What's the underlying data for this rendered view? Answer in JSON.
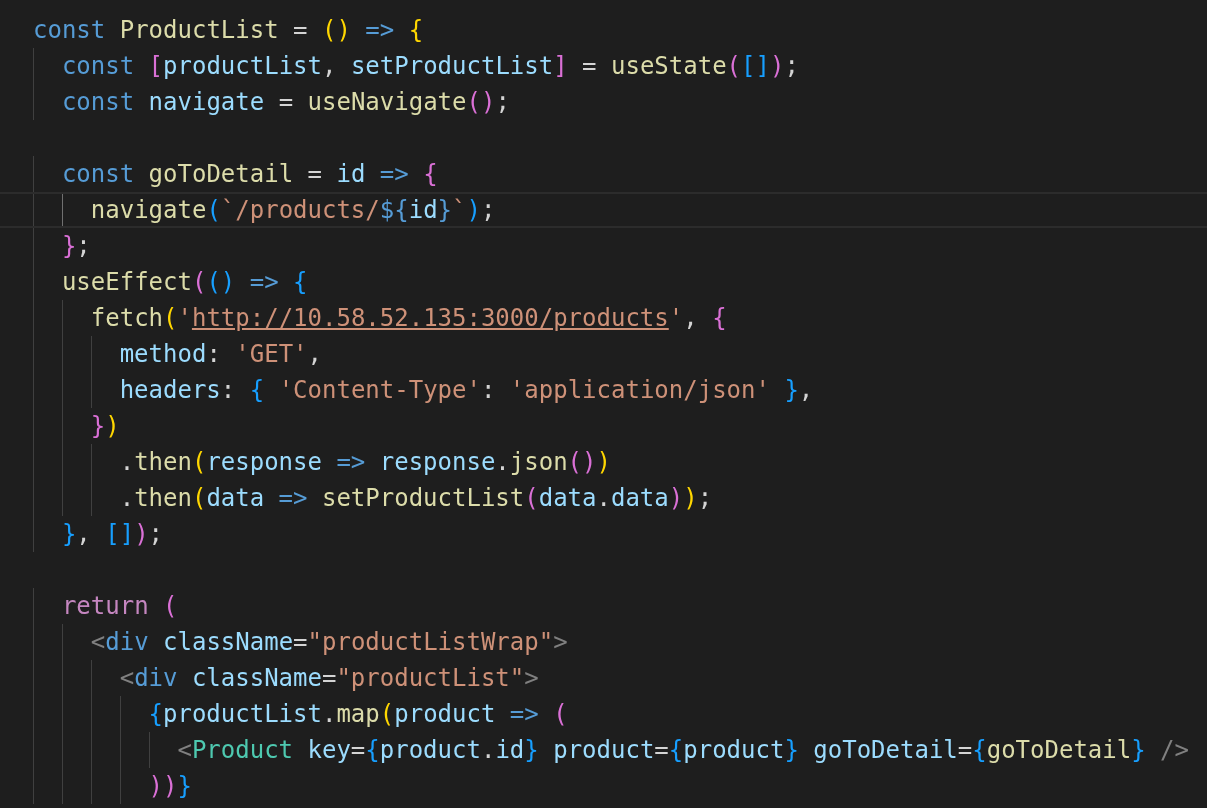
{
  "editor": {
    "lines": [
      {
        "current": false,
        "tokens": [
          {
            "text": "const ",
            "kind": "kw"
          },
          {
            "text": "ProductList",
            "kind": "fn"
          },
          {
            "text": " = ",
            "kind": "p"
          },
          {
            "text": "()",
            "kind": "b1"
          },
          {
            "text": " => ",
            "kind": "kw"
          },
          {
            "text": "{",
            "kind": "b1"
          }
        ]
      },
      {
        "current": false,
        "tokens": [
          {
            "text": "  const ",
            "kind": "kw"
          },
          {
            "text": "[",
            "kind": "b2"
          },
          {
            "text": "productList",
            "kind": "var"
          },
          {
            "text": ", ",
            "kind": "p"
          },
          {
            "text": "setProductList",
            "kind": "var"
          },
          {
            "text": "]",
            "kind": "b2"
          },
          {
            "text": " = ",
            "kind": "p"
          },
          {
            "text": "useState",
            "kind": "fn"
          },
          {
            "text": "(",
            "kind": "b2"
          },
          {
            "text": "[]",
            "kind": "b3"
          },
          {
            "text": ")",
            "kind": "b2"
          },
          {
            "text": ";",
            "kind": "p"
          }
        ]
      },
      {
        "current": false,
        "tokens": [
          {
            "text": "  const ",
            "kind": "kw"
          },
          {
            "text": "navigate",
            "kind": "var"
          },
          {
            "text": " = ",
            "kind": "p"
          },
          {
            "text": "useNavigate",
            "kind": "fn"
          },
          {
            "text": "()",
            "kind": "b2"
          },
          {
            "text": ";",
            "kind": "p"
          }
        ]
      },
      {
        "current": false
      },
      {
        "current": false,
        "tokens": [
          {
            "text": "  const ",
            "kind": "kw"
          },
          {
            "text": "goToDetail",
            "kind": "fn"
          },
          {
            "text": " = ",
            "kind": "p"
          },
          {
            "text": "id",
            "kind": "var"
          },
          {
            "text": " => ",
            "kind": "kw"
          },
          {
            "text": "{",
            "kind": "b2"
          }
        ]
      },
      {
        "current": true,
        "tokens": [
          {
            "text": "    navigate",
            "kind": "fn"
          },
          {
            "text": "(",
            "kind": "b3"
          },
          {
            "text": "`/products/",
            "kind": "str"
          },
          {
            "text": "${",
            "kind": "kw"
          },
          {
            "text": "id",
            "kind": "var"
          },
          {
            "text": "}",
            "kind": "kw"
          },
          {
            "text": "`",
            "kind": "str"
          },
          {
            "text": ")",
            "kind": "b3"
          },
          {
            "text": ";",
            "kind": "p"
          }
        ]
      },
      {
        "current": false,
        "tokens": [
          {
            "text": "  }",
            "kind": "b2"
          },
          {
            "text": ";",
            "kind": "p"
          }
        ]
      },
      {
        "current": false,
        "tokens": [
          {
            "text": "  useEffect",
            "kind": "fn"
          },
          {
            "text": "(",
            "kind": "b2"
          },
          {
            "text": "()",
            "kind": "b3"
          },
          {
            "text": " => ",
            "kind": "kw"
          },
          {
            "text": "{",
            "kind": "b3"
          }
        ]
      },
      {
        "current": false,
        "tokens": [
          {
            "text": "    fetch",
            "kind": "fn"
          },
          {
            "text": "(",
            "kind": "b1"
          },
          {
            "text": "'",
            "kind": "str"
          },
          {
            "text": "http://10.58.52.135:3000/products",
            "kind": "url"
          },
          {
            "text": "'",
            "kind": "str"
          },
          {
            "text": ", ",
            "kind": "p"
          },
          {
            "text": "{",
            "kind": "b2"
          }
        ]
      },
      {
        "current": false,
        "tokens": [
          {
            "text": "      method",
            "kind": "var"
          },
          {
            "text": ": ",
            "kind": "p"
          },
          {
            "text": "'GET'",
            "kind": "str"
          },
          {
            "text": ",",
            "kind": "p"
          }
        ]
      },
      {
        "current": false,
        "tokens": [
          {
            "text": "      headers",
            "kind": "var"
          },
          {
            "text": ": ",
            "kind": "p"
          },
          {
            "text": "{ ",
            "kind": "b3"
          },
          {
            "text": "'Content-Type'",
            "kind": "str"
          },
          {
            "text": ": ",
            "kind": "p"
          },
          {
            "text": "'application/json'",
            "kind": "str"
          },
          {
            "text": " }",
            "kind": "b3"
          },
          {
            "text": ",",
            "kind": "p"
          }
        ]
      },
      {
        "current": false,
        "tokens": [
          {
            "text": "    }",
            "kind": "b2"
          },
          {
            "text": ")",
            "kind": "b1"
          }
        ]
      },
      {
        "current": false,
        "tokens": [
          {
            "text": "      .",
            "kind": "p"
          },
          {
            "text": "then",
            "kind": "fn"
          },
          {
            "text": "(",
            "kind": "b1"
          },
          {
            "text": "response",
            "kind": "var"
          },
          {
            "text": " => ",
            "kind": "kw"
          },
          {
            "text": "response",
            "kind": "var"
          },
          {
            "text": ".",
            "kind": "p"
          },
          {
            "text": "json",
            "kind": "fn"
          },
          {
            "text": "()",
            "kind": "b2"
          },
          {
            "text": ")",
            "kind": "b1"
          }
        ]
      },
      {
        "current": false,
        "tokens": [
          {
            "text": "      .",
            "kind": "p"
          },
          {
            "text": "then",
            "kind": "fn"
          },
          {
            "text": "(",
            "kind": "b1"
          },
          {
            "text": "data",
            "kind": "var"
          },
          {
            "text": " => ",
            "kind": "kw"
          },
          {
            "text": "setProductList",
            "kind": "fn"
          },
          {
            "text": "(",
            "kind": "b2"
          },
          {
            "text": "data",
            "kind": "var"
          },
          {
            "text": ".",
            "kind": "p"
          },
          {
            "text": "data",
            "kind": "var"
          },
          {
            "text": ")",
            "kind": "b2"
          },
          {
            "text": ")",
            "kind": "b1"
          },
          {
            "text": ";",
            "kind": "p"
          }
        ]
      },
      {
        "current": false,
        "tokens": [
          {
            "text": "  }",
            "kind": "b3"
          },
          {
            "text": ", ",
            "kind": "p"
          },
          {
            "text": "[]",
            "kind": "b3"
          },
          {
            "text": ")",
            "kind": "b2"
          },
          {
            "text": ";",
            "kind": "p"
          }
        ]
      },
      {
        "current": false
      },
      {
        "current": false,
        "tokens": [
          {
            "text": "  return ",
            "kind": "ctl"
          },
          {
            "text": "(",
            "kind": "b2"
          }
        ]
      },
      {
        "current": false,
        "tokens": [
          {
            "text": "    <",
            "kind": "tag"
          },
          {
            "text": "div ",
            "kind": "kw"
          },
          {
            "text": "className",
            "kind": "var"
          },
          {
            "text": "=",
            "kind": "p"
          },
          {
            "text": "\"productListWrap\"",
            "kind": "str"
          },
          {
            "text": ">",
            "kind": "tag"
          }
        ]
      },
      {
        "current": false,
        "tokens": [
          {
            "text": "      <",
            "kind": "tag"
          },
          {
            "text": "div ",
            "kind": "kw"
          },
          {
            "text": "className",
            "kind": "var"
          },
          {
            "text": "=",
            "kind": "p"
          },
          {
            "text": "\"productList\"",
            "kind": "str"
          },
          {
            "text": ">",
            "kind": "tag"
          }
        ]
      },
      {
        "current": false,
        "tokens": [
          {
            "text": "        {",
            "kind": "b3"
          },
          {
            "text": "productList",
            "kind": "var"
          },
          {
            "text": ".",
            "kind": "p"
          },
          {
            "text": "map",
            "kind": "fn"
          },
          {
            "text": "(",
            "kind": "b1"
          },
          {
            "text": "product",
            "kind": "var"
          },
          {
            "text": " => ",
            "kind": "kw"
          },
          {
            "text": "(",
            "kind": "b2"
          }
        ]
      },
      {
        "current": false,
        "tokens": [
          {
            "text": "          <",
            "kind": "tag"
          },
          {
            "text": "Product ",
            "kind": "comp"
          },
          {
            "text": "key",
            "kind": "var"
          },
          {
            "text": "=",
            "kind": "p"
          },
          {
            "text": "{",
            "kind": "b3"
          },
          {
            "text": "product",
            "kind": "var"
          },
          {
            "text": ".",
            "kind": "p"
          },
          {
            "text": "id",
            "kind": "var"
          },
          {
            "text": "}",
            "kind": "b3"
          },
          {
            "text": " product",
            "kind": "var"
          },
          {
            "text": "=",
            "kind": "p"
          },
          {
            "text": "{",
            "kind": "b3"
          },
          {
            "text": "product",
            "kind": "var"
          },
          {
            "text": "}",
            "kind": "b3"
          },
          {
            "text": " goToDetail",
            "kind": "var"
          },
          {
            "text": "=",
            "kind": "p"
          },
          {
            "text": "{",
            "kind": "b3"
          },
          {
            "text": "goToDetail",
            "kind": "fn"
          },
          {
            "text": "}",
            "kind": "b3"
          },
          {
            "text": " /",
            "kind": "tag"
          },
          {
            "text": ">",
            "kind": "tag"
          }
        ]
      },
      {
        "current": false,
        "tokens": [
          {
            "text": "        ))",
            "kind": "b2"
          },
          {
            "text": "}",
            "kind": "b3"
          }
        ]
      }
    ]
  }
}
